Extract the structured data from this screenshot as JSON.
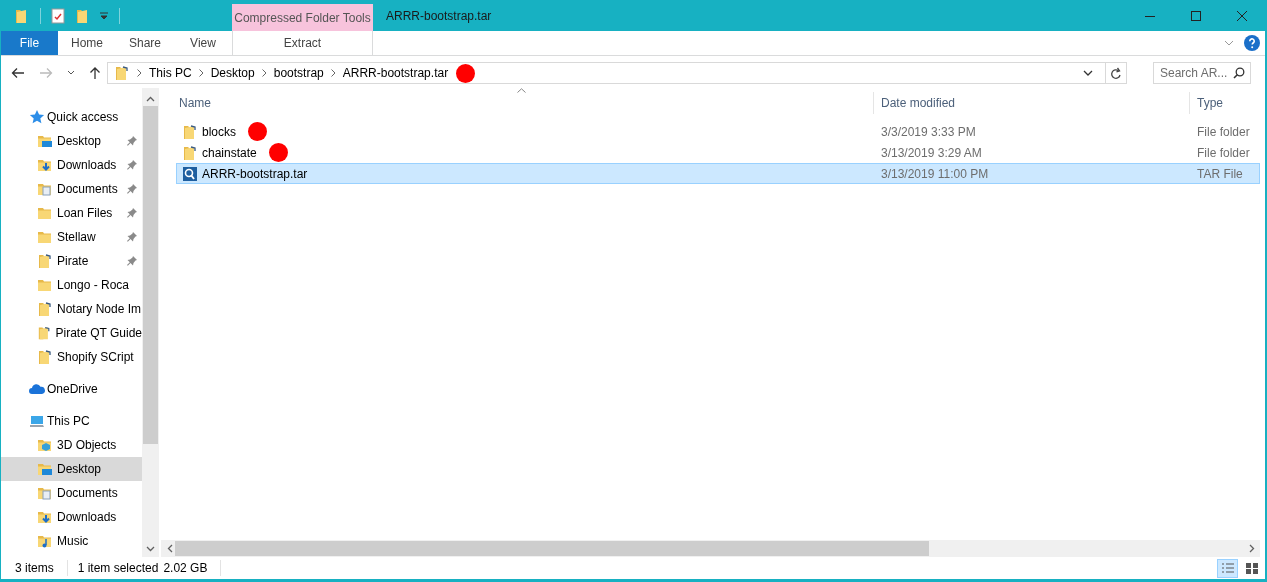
{
  "window": {
    "title": "ARRR-bootstrap.tar"
  },
  "ribbon": {
    "context_group": "Compressed Folder Tools",
    "tabs": [
      {
        "label": "File",
        "kind": "file",
        "selected": false
      },
      {
        "label": "Home",
        "kind": "plain",
        "selected": false
      },
      {
        "label": "Share",
        "kind": "plain",
        "selected": false
      },
      {
        "label": "View",
        "kind": "plain",
        "selected": false
      },
      {
        "label": "Extract",
        "kind": "context",
        "selected": false
      }
    ]
  },
  "address_bar": {
    "path": [
      {
        "label": "This PC",
        "marked": false
      },
      {
        "label": "Desktop",
        "marked": false
      },
      {
        "label": "bootstrap",
        "marked": false
      },
      {
        "label": "ARRR-bootstrap.tar",
        "marked": true
      }
    ]
  },
  "search": {
    "placeholder": "Search AR..."
  },
  "navigation": {
    "items": [
      {
        "label": "Quick access",
        "kind": "star",
        "selected": false,
        "children": [
          {
            "label": "Desktop",
            "kind": "desktop",
            "pinned": true,
            "selected": false
          },
          {
            "label": "Downloads",
            "kind": "downloads",
            "pinned": true,
            "selected": false
          },
          {
            "label": "Documents",
            "kind": "documents",
            "pinned": true,
            "selected": false
          },
          {
            "label": "Loan Files",
            "kind": "folder",
            "pinned": true,
            "selected": false
          },
          {
            "label": "Stellaw",
            "kind": "folder",
            "pinned": true,
            "selected": false
          },
          {
            "label": "Pirate",
            "kind": "shortcut",
            "pinned": true,
            "selected": false
          },
          {
            "label": "Longo - Roca",
            "kind": "folder",
            "pinned": false,
            "selected": false
          },
          {
            "label": "Notary Node Im",
            "kind": "shortcut",
            "pinned": false,
            "selected": false
          },
          {
            "label": "Pirate QT Guide",
            "kind": "shortcut",
            "pinned": false,
            "selected": false
          },
          {
            "label": "Shopify SCript",
            "kind": "shortcut",
            "pinned": false,
            "selected": false
          }
        ]
      },
      {
        "label": "OneDrive",
        "kind": "cloud",
        "selected": false
      },
      {
        "label": "This PC",
        "kind": "pc",
        "selected": false,
        "children": [
          {
            "label": "3D Objects",
            "kind": "objects",
            "pinned": false,
            "selected": false
          },
          {
            "label": "Desktop",
            "kind": "desktop",
            "pinned": false,
            "selected": true
          },
          {
            "label": "Documents",
            "kind": "documents",
            "pinned": false,
            "selected": false
          },
          {
            "label": "Downloads",
            "kind": "downloads",
            "pinned": false,
            "selected": false
          },
          {
            "label": "Music",
            "kind": "music",
            "pinned": false,
            "selected": false
          }
        ]
      }
    ]
  },
  "file_list": {
    "columns": [
      "Name",
      "Date modified",
      "Type"
    ],
    "rows": [
      {
        "name": "blocks",
        "kind": "shortcut",
        "date": "3/3/2019 3:33 PM",
        "type": "File folder",
        "selected": false,
        "marked": true
      },
      {
        "name": "chainstate",
        "kind": "shortcut",
        "date": "3/13/2019 3:29 AM",
        "type": "File folder",
        "selected": false,
        "marked": true
      },
      {
        "name": "ARRR-bootstrap.tar",
        "kind": "archive",
        "date": "3/13/2019 11:00 PM",
        "type": "TAR File",
        "selected": true,
        "marked": false
      }
    ]
  },
  "status_bar": {
    "item_count": "3 items",
    "selection": "1 item selected",
    "size": "2.02 GB",
    "views": [
      {
        "kind": "details",
        "selected": true
      },
      {
        "kind": "tiles",
        "selected": false
      }
    ]
  }
}
